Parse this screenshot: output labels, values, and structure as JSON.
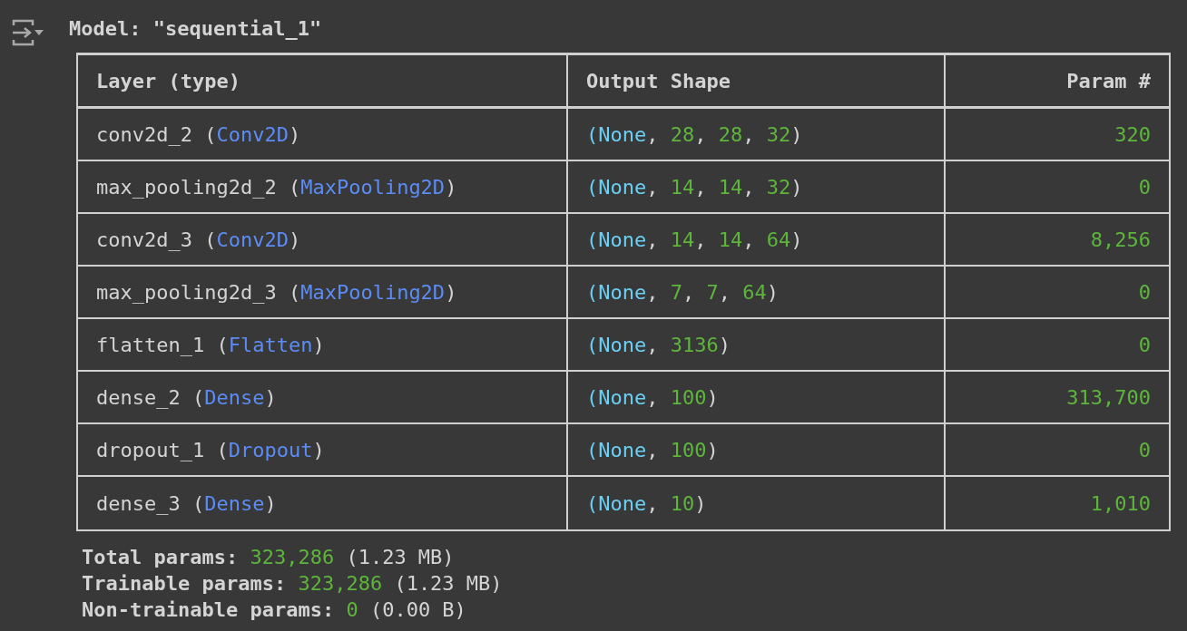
{
  "title": "Model: \"sequential_1\"",
  "table": {
    "columns": [
      "Layer (type)",
      "Output Shape",
      "Param #"
    ],
    "rows": [
      {
        "layer": [
          {
            "text": "conv2d_2 (",
            "kind": "plain"
          },
          {
            "text": "Conv2D",
            "kind": "class"
          },
          {
            "text": ")",
            "kind": "plain"
          }
        ],
        "shape": [
          {
            "text": "(None",
            "kind": "keyword"
          },
          {
            "text": ", ",
            "kind": "plain"
          },
          {
            "text": "28",
            "kind": "number"
          },
          {
            "text": ", ",
            "kind": "plain"
          },
          {
            "text": "28",
            "kind": "number"
          },
          {
            "text": ", ",
            "kind": "plain"
          },
          {
            "text": "32",
            "kind": "number"
          },
          {
            "text": ")",
            "kind": "plain"
          }
        ],
        "params": "320"
      },
      {
        "layer": [
          {
            "text": "max_pooling2d_2 (",
            "kind": "plain"
          },
          {
            "text": "MaxPooling2D",
            "kind": "class"
          },
          {
            "text": ")",
            "kind": "plain"
          }
        ],
        "shape": [
          {
            "text": "(None",
            "kind": "keyword"
          },
          {
            "text": ", ",
            "kind": "plain"
          },
          {
            "text": "14",
            "kind": "number"
          },
          {
            "text": ", ",
            "kind": "plain"
          },
          {
            "text": "14",
            "kind": "number"
          },
          {
            "text": ", ",
            "kind": "plain"
          },
          {
            "text": "32",
            "kind": "number"
          },
          {
            "text": ")",
            "kind": "plain"
          }
        ],
        "params": "0"
      },
      {
        "layer": [
          {
            "text": "conv2d_3 (",
            "kind": "plain"
          },
          {
            "text": "Conv2D",
            "kind": "class"
          },
          {
            "text": ")",
            "kind": "plain"
          }
        ],
        "shape": [
          {
            "text": "(None",
            "kind": "keyword"
          },
          {
            "text": ", ",
            "kind": "plain"
          },
          {
            "text": "14",
            "kind": "number"
          },
          {
            "text": ", ",
            "kind": "plain"
          },
          {
            "text": "14",
            "kind": "number"
          },
          {
            "text": ", ",
            "kind": "plain"
          },
          {
            "text": "64",
            "kind": "number"
          },
          {
            "text": ")",
            "kind": "plain"
          }
        ],
        "params": "8,256"
      },
      {
        "layer": [
          {
            "text": "max_pooling2d_3 (",
            "kind": "plain"
          },
          {
            "text": "MaxPooling2D",
            "kind": "class"
          },
          {
            "text": ")",
            "kind": "plain"
          }
        ],
        "shape": [
          {
            "text": "(None",
            "kind": "keyword"
          },
          {
            "text": ", ",
            "kind": "plain"
          },
          {
            "text": "7",
            "kind": "number"
          },
          {
            "text": ", ",
            "kind": "plain"
          },
          {
            "text": "7",
            "kind": "number"
          },
          {
            "text": ", ",
            "kind": "plain"
          },
          {
            "text": "64",
            "kind": "number"
          },
          {
            "text": ")",
            "kind": "plain"
          }
        ],
        "params": "0"
      },
      {
        "layer": [
          {
            "text": "flatten_1 (",
            "kind": "plain"
          },
          {
            "text": "Flatten",
            "kind": "class"
          },
          {
            "text": ")",
            "kind": "plain"
          }
        ],
        "shape": [
          {
            "text": "(None",
            "kind": "keyword"
          },
          {
            "text": ", ",
            "kind": "plain"
          },
          {
            "text": "3136",
            "kind": "number"
          },
          {
            "text": ")",
            "kind": "plain"
          }
        ],
        "params": "0"
      },
      {
        "layer": [
          {
            "text": "dense_2 (",
            "kind": "plain"
          },
          {
            "text": "Dense",
            "kind": "class"
          },
          {
            "text": ")",
            "kind": "plain"
          }
        ],
        "shape": [
          {
            "text": "(None",
            "kind": "keyword"
          },
          {
            "text": ", ",
            "kind": "plain"
          },
          {
            "text": "100",
            "kind": "number"
          },
          {
            "text": ")",
            "kind": "plain"
          }
        ],
        "params": "313,700"
      },
      {
        "layer": [
          {
            "text": "dropout_1 (",
            "kind": "plain"
          },
          {
            "text": "Dropout",
            "kind": "class"
          },
          {
            "text": ")",
            "kind": "plain"
          }
        ],
        "shape": [
          {
            "text": "(None",
            "kind": "keyword"
          },
          {
            "text": ", ",
            "kind": "plain"
          },
          {
            "text": "100",
            "kind": "number"
          },
          {
            "text": ")",
            "kind": "plain"
          }
        ],
        "params": "0"
      },
      {
        "layer": [
          {
            "text": "dense_3 (",
            "kind": "plain"
          },
          {
            "text": "Dense",
            "kind": "class"
          },
          {
            "text": ")",
            "kind": "plain"
          }
        ],
        "shape": [
          {
            "text": "(None",
            "kind": "keyword"
          },
          {
            "text": ", ",
            "kind": "plain"
          },
          {
            "text": "10",
            "kind": "number"
          },
          {
            "text": ")",
            "kind": "plain"
          }
        ],
        "params": "1,010"
      }
    ]
  },
  "summary": [
    [
      {
        "text": "Total params: ",
        "kind": "label"
      },
      {
        "text": "323,286",
        "kind": "number"
      },
      {
        "text": " (1.23 MB)",
        "kind": "plain"
      }
    ],
    [
      {
        "text": "Trainable params: ",
        "kind": "label"
      },
      {
        "text": "323,286",
        "kind": "number"
      },
      {
        "text": " (1.23 MB)",
        "kind": "plain"
      }
    ],
    [
      {
        "text": "Non-trainable params: ",
        "kind": "label"
      },
      {
        "text": "0",
        "kind": "number"
      },
      {
        "text": " (0.00 B)",
        "kind": "plain"
      }
    ]
  ]
}
